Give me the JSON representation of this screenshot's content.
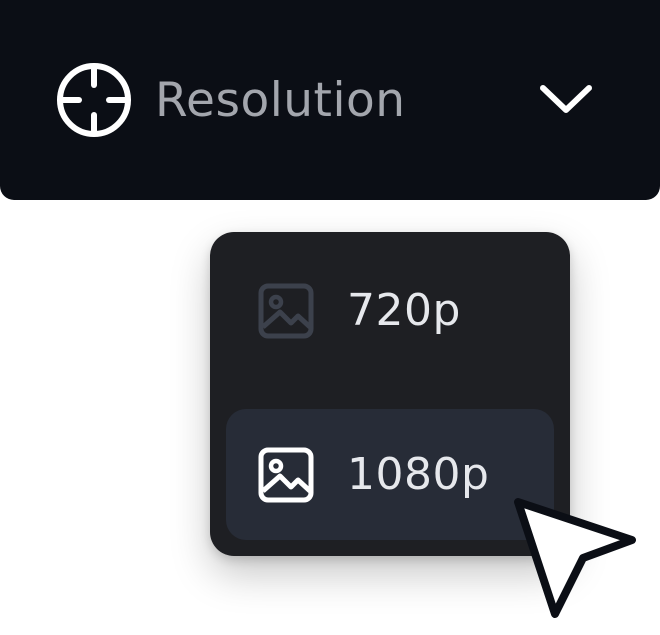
{
  "dropdown": {
    "label": "Resolution",
    "icon": "crosshair-icon",
    "toggle_icon": "chevron-down-icon",
    "expanded": true
  },
  "menu": {
    "items": [
      {
        "label": "720p",
        "icon": "image-icon",
        "state": "disabled-dim"
      },
      {
        "label": "1080p",
        "icon": "image-icon",
        "state": "hovered"
      }
    ]
  },
  "colors": {
    "header_bg": "#0b0e15",
    "header_text": "#a3a6ad",
    "menu_bg": "#1e1f23",
    "hover_bg": "#272c37",
    "item_text": "#e6e8ec",
    "dim_icon": "#3c414c"
  },
  "pointer": {
    "icon": "mouse-pointer-icon"
  }
}
